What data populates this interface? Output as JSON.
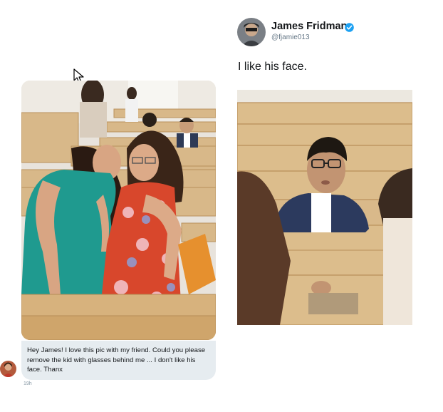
{
  "message": {
    "lines": [
      "Hey James! I love this pic with my friend. Could you please",
      "remove the kid with glasses behind me ... I don't like his",
      "face. Thanx"
    ],
    "time": "19h"
  },
  "reply": {
    "name": "James Fridman",
    "handle": "@fjamie013",
    "text": "I like his face."
  },
  "icons": [
    "verified-badge-icon",
    "mouse-cursor-icon"
  ],
  "colors": {
    "verified_blue": "#1da1f2",
    "bubble_gray": "#e6ecf0",
    "wood": "#d9b98a"
  }
}
